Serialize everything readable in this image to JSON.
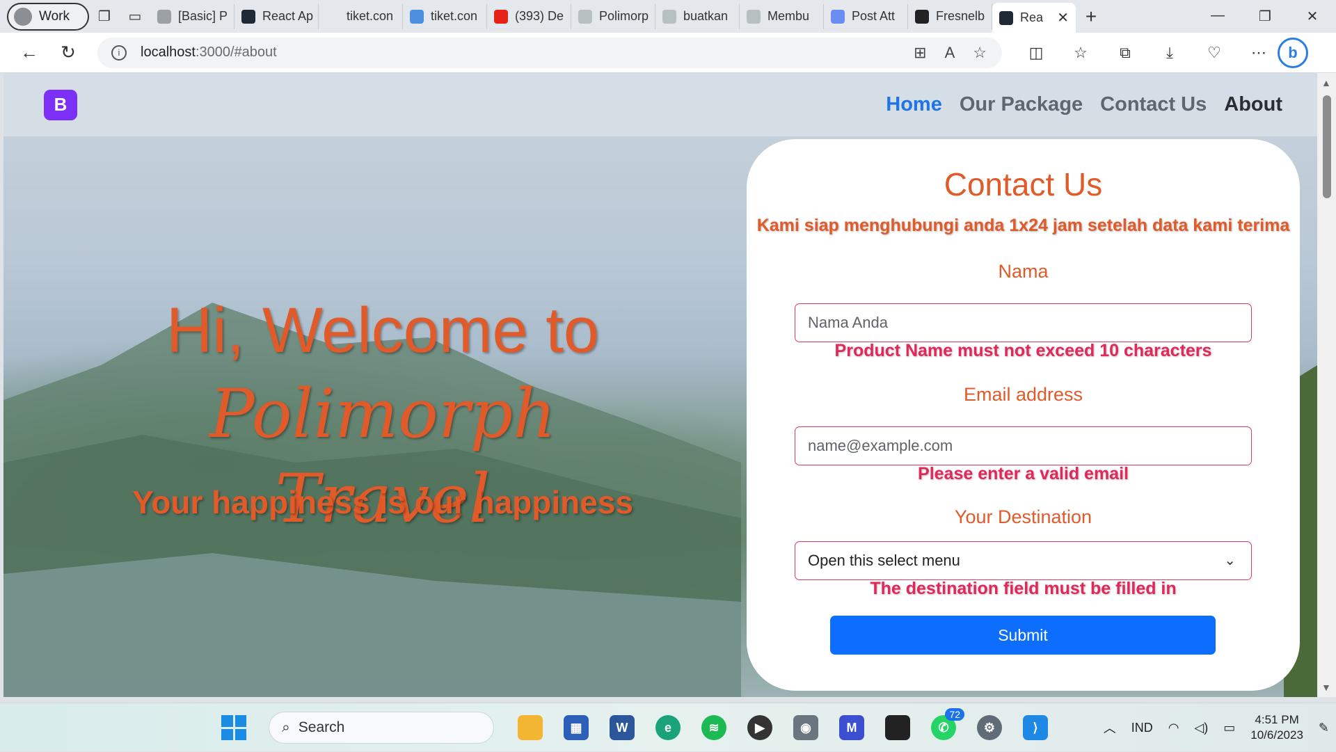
{
  "browser": {
    "profile_label": "Work",
    "tabs": [
      {
        "label": "[Basic] P",
        "color": "#9aa0a6"
      },
      {
        "label": "React Ap",
        "color": "#1f2a36"
      },
      {
        "label": "tiket.con",
        "color": "#e4e7eb"
      },
      {
        "label": "tiket.con",
        "color": "#4a8fe0"
      },
      {
        "label": "(393) De",
        "color": "#e62117"
      },
      {
        "label": "Polimorp",
        "color": "#b7c0c0"
      },
      {
        "label": "buatkan",
        "color": "#b7c0c0"
      },
      {
        "label": "Membu",
        "color": "#b7c0c0"
      },
      {
        "label": "Post Att",
        "color": "#6b8cf0"
      },
      {
        "label": "Fresnelb",
        "color": "#222222"
      }
    ],
    "active_tab_label": "Rea",
    "url_host": "localhost",
    "url_path": ":3000/#about"
  },
  "navbar": {
    "brand": "B",
    "links": [
      "Home",
      "Our Package",
      "Contact Us",
      "About"
    ]
  },
  "hero": {
    "title_plain": "Hi, Welcome to",
    "title_script_1": "Polimorph",
    "title_script_2": "Travel",
    "subtitle": "Your happiness is our happiness"
  },
  "form": {
    "title": "Contact Us",
    "tagline": "Kami siap menghubungi anda 1x24 jam setelah data kami terima",
    "name_label": "Nama",
    "name_placeholder": "Nama Anda",
    "name_error": "Product Name must not exceed 10 characters",
    "email_label": "Email address",
    "email_placeholder": "name@example.com",
    "email_error": "Please enter a valid email",
    "dest_label": "Your Destination",
    "dest_value": "Open this select menu",
    "dest_error": "The destination field must be filled in",
    "submit_label": "Submit"
  },
  "taskbar": {
    "search_label": "Search",
    "whatsapp_badge": "72",
    "language": "IND",
    "time": "4:51 PM",
    "date": "10/6/2023"
  },
  "colors": {
    "accent_orange": "#e05a2a",
    "error_red": "#e0295a",
    "primary_blue": "#0d6efd",
    "brand_purple": "#7b2ff7"
  }
}
